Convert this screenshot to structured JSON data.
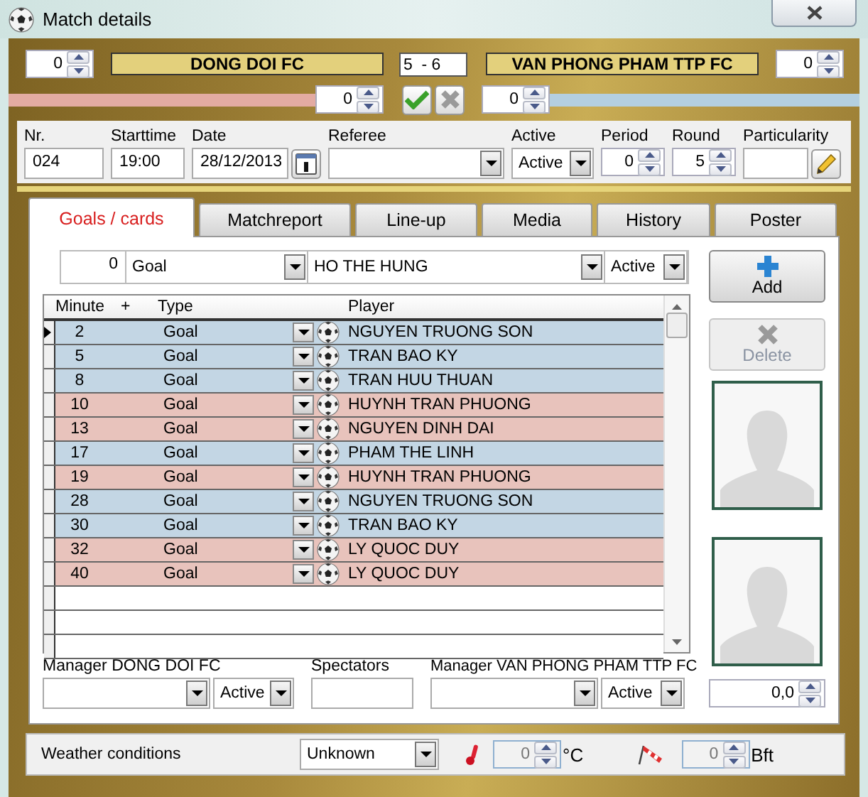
{
  "window": {
    "title": "Match details"
  },
  "score_header": {
    "home": {
      "team": "DONG DOI FC",
      "value": "0",
      "sub_value": "0",
      "color": "#e3aba2"
    },
    "score": "5  - 6",
    "away": {
      "team": "VAN PHONG PHAM TTP FC",
      "value": "0",
      "sub_value": "0",
      "color": "#b4cfe0"
    }
  },
  "info": [
    {
      "kind": "text",
      "label": "Nr.",
      "value": "024"
    },
    {
      "kind": "text",
      "label": "Starttime",
      "value": "19:00"
    },
    {
      "kind": "date",
      "label": "Date",
      "value": "28/12/2013"
    },
    {
      "kind": "combo",
      "label": "Referee"
    },
    {
      "kind": "combo",
      "label": "Active",
      "value": "Active"
    },
    {
      "kind": "spin",
      "label": "Period",
      "value": "0"
    },
    {
      "kind": "spin",
      "label": "Round",
      "value": "5"
    },
    {
      "kind": "edit",
      "label": "Particularity"
    }
  ],
  "tabs": [
    {
      "label": "Goals / cards",
      "selected": true
    },
    {
      "label": "Matchreport",
      "selected": false
    },
    {
      "label": "Line-up",
      "selected": false
    },
    {
      "label": "Media",
      "selected": false
    },
    {
      "label": "History",
      "selected": false
    },
    {
      "label": "Poster",
      "selected": false
    }
  ],
  "event_filter": {
    "minute": "0",
    "type": "Goal",
    "player": "HO THE HUNG",
    "status": "Active"
  },
  "actions": [
    {
      "label": "Add",
      "disabled": false
    },
    {
      "label": "Delete",
      "disabled": true
    }
  ],
  "events": {
    "columns": [
      "Minute",
      "+",
      "Type",
      "Player"
    ],
    "rows": [
      {
        "minute": "2",
        "type": "Goal",
        "player": "NGUYEN TRUONG SON",
        "color": "#c3d6e4",
        "selected": true
      },
      {
        "minute": "5",
        "type": "Goal",
        "player": "TRAN BAO KY",
        "color": "#c3d6e4",
        "selected": false
      },
      {
        "minute": "8",
        "type": "Goal",
        "player": "TRAN HUU THUAN",
        "color": "#c3d6e4",
        "selected": false
      },
      {
        "minute": "10",
        "type": "Goal",
        "player": "HUYNH TRAN PHUONG",
        "color": "#e8c3bc",
        "selected": false
      },
      {
        "minute": "13",
        "type": "Goal",
        "player": "NGUYEN DINH DAI",
        "color": "#e8c3bc",
        "selected": false
      },
      {
        "minute": "17",
        "type": "Goal",
        "player": "PHAM THE LINH",
        "color": "#c3d6e4",
        "selected": false
      },
      {
        "minute": "19",
        "type": "Goal",
        "player": "HUYNH TRAN PHUONG",
        "color": "#e8c3bc",
        "selected": false
      },
      {
        "minute": "28",
        "type": "Goal",
        "player": "NGUYEN TRUONG SON",
        "color": "#c3d6e4",
        "selected": false
      },
      {
        "minute": "30",
        "type": "Goal",
        "player": "TRAN BAO KY",
        "color": "#c3d6e4",
        "selected": false
      },
      {
        "minute": "32",
        "type": "Goal",
        "player": "LY QUOC DUY",
        "color": "#e8c3bc",
        "selected": false
      },
      {
        "minute": "40",
        "type": "Goal",
        "player": "LY QUOC DUY",
        "color": "#e8c3bc",
        "selected": false
      }
    ]
  },
  "managers": [
    {
      "label": "Manager DONG DOI FC",
      "status": "Active"
    },
    {
      "label": "Manager VAN PHONG PHAM TTP FC",
      "status": "Active"
    }
  ],
  "spectators": {
    "label": "Spectators"
  },
  "rating": "0,0",
  "weather": {
    "label": "Weather conditions",
    "condition": "Unknown",
    "temperature": {
      "value": "0",
      "unit": "°C",
      "disabled": true
    },
    "wind": {
      "value": "0",
      "unit": "Bft",
      "disabled": true
    }
  }
}
